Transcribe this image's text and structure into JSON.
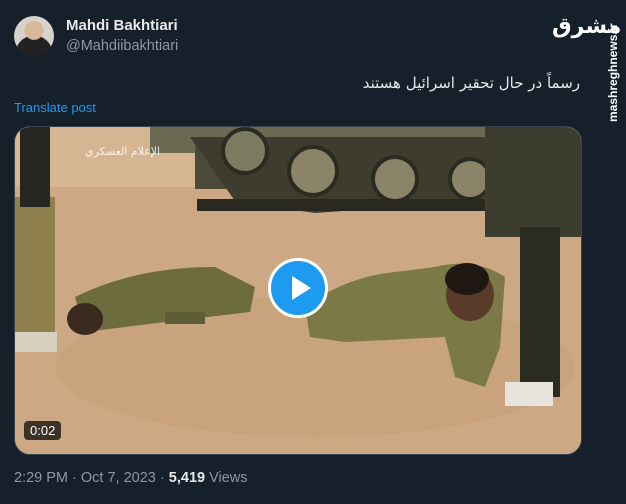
{
  "tweet": {
    "author_name": "Mahdi Bakhtiari",
    "handle": "@Mahdiibakhtiari",
    "text": "رسماً در حال تحقیر اسرائیل هستند",
    "translate_label": "Translate post",
    "time": "2:29 PM",
    "separator": "·",
    "date": "Oct 7, 2023",
    "views_count": "5,419",
    "views_label": "Views"
  },
  "watermark": {
    "logo_text": "مشرق",
    "side_text": "mashreghnews.ir"
  },
  "video": {
    "duration": "0:02",
    "channel_text": "الإعلام العسكري"
  },
  "colors": {
    "background": "#15202b",
    "accent": "#1d9bf0",
    "secondary_text": "#8b98a5"
  }
}
